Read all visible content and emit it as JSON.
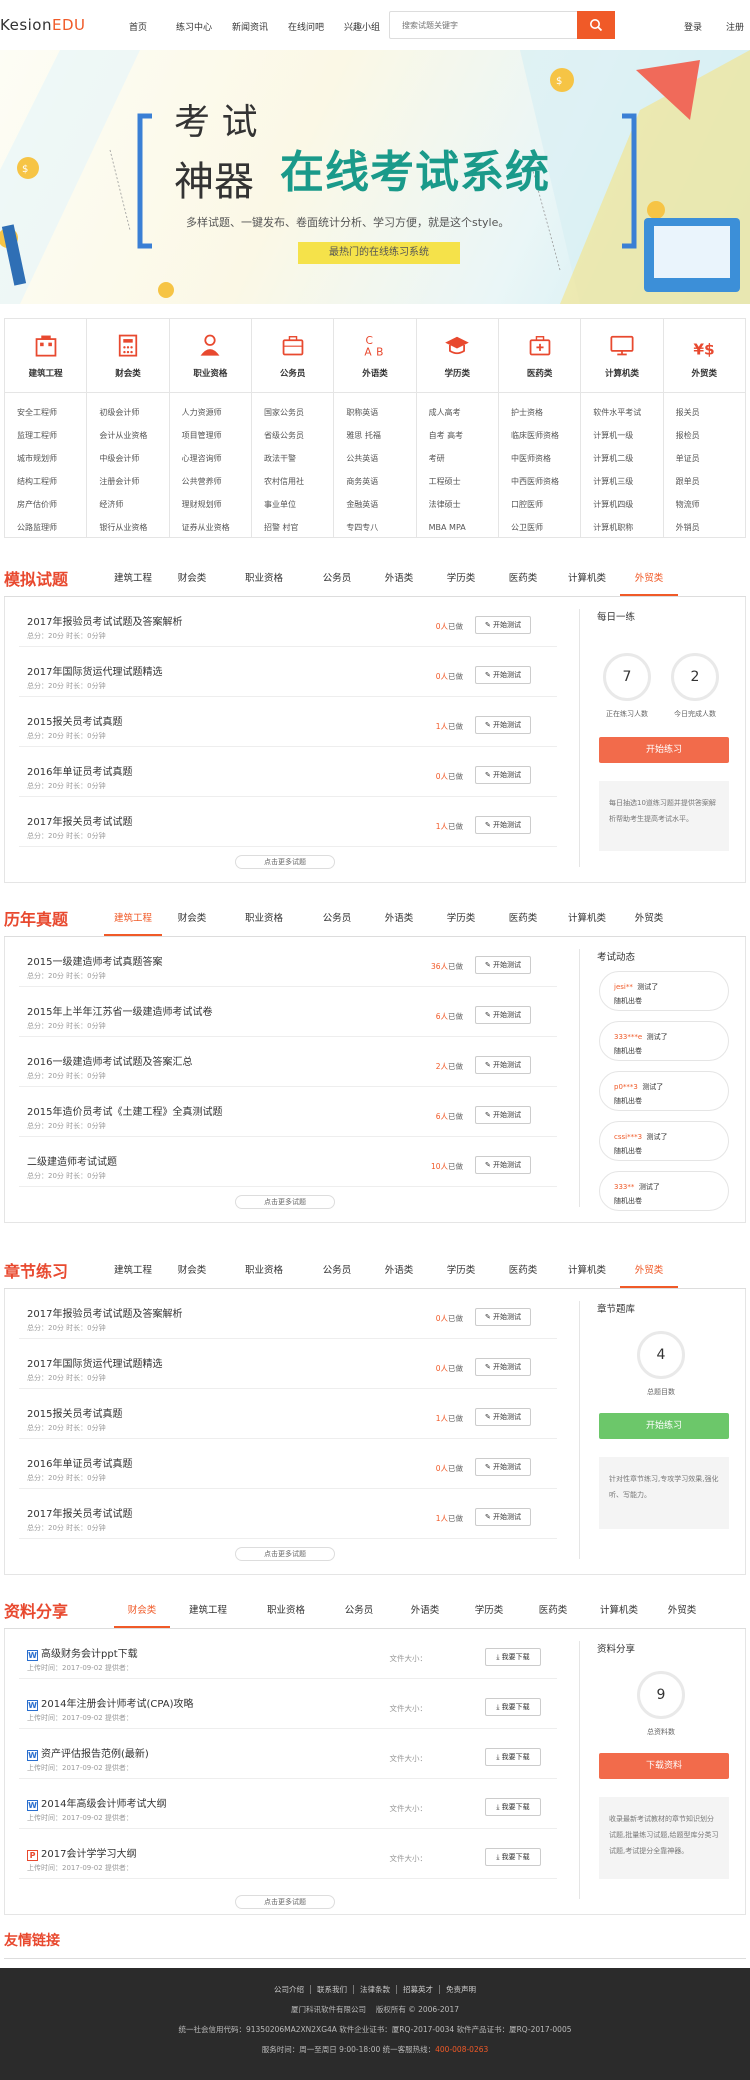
{
  "header": {
    "logo_main": "Kesion",
    "logo_edu": "EDU",
    "nav": [
      "首页",
      "练习中心",
      "新闻资讯",
      "在线问吧",
      "兴趣小组"
    ],
    "search_placeholder": "搜索试题关键字",
    "login": "登录",
    "register": "注册"
  },
  "banner": {
    "big1": "考 试",
    "big2": "神器",
    "title": "在线考试系统",
    "subtitle": "多样试题、一键发布、卷面统计分析、学习方便，就是这个style。",
    "tag": "最热门的在线练习系统"
  },
  "categories": [
    {
      "name": "建筑工程",
      "icon": "building-icon",
      "items": [
        "安全工程师",
        "监理工程师",
        "城市规划师",
        "结构工程师",
        "房产估价师",
        "公路监理师"
      ]
    },
    {
      "name": "财会类",
      "icon": "calculator-icon",
      "items": [
        "初级会计师",
        "会计从业资格",
        "中级会计师",
        "注册会计师",
        "经济师",
        "银行从业资格"
      ]
    },
    {
      "name": "职业资格",
      "icon": "person-icon",
      "items": [
        "人力资源师",
        "项目管理师",
        "心理咨询师",
        "公共营养师",
        "理财规划师",
        "证券从业资格"
      ]
    },
    {
      "name": "公务员",
      "icon": "briefcase-icon",
      "items": [
        "国家公务员",
        "省级公务员",
        "政法干警",
        "农村信用社",
        "事业单位",
        "招警    村官"
      ]
    },
    {
      "name": "外语类",
      "icon": "abc-icon",
      "items": [
        "职称英语",
        "雅思    托福",
        "公共英语",
        "商务英语",
        "金融英语",
        "专四专八"
      ]
    },
    {
      "name": "学历类",
      "icon": "graduation-cap-icon",
      "items": [
        "成人高考",
        "自考    高考",
        "考研",
        "工程硕士",
        "法律硕士",
        "MBA    MPA"
      ]
    },
    {
      "name": "医药类",
      "icon": "medical-kit-icon",
      "items": [
        "护士资格",
        "临床医师资格",
        "中医师资格",
        "中西医师资格",
        "口腔医师",
        "公卫医师"
      ]
    },
    {
      "name": "计算机类",
      "icon": "monitor-icon",
      "items": [
        "软件水平考试",
        "计算机一级",
        "计算机二级",
        "计算机三级",
        "计算机四级",
        "计算机职称"
      ]
    },
    {
      "name": "外贸类",
      "icon": "trade-icon",
      "items": [
        "报关员",
        "报检员",
        "单证员",
        "跟单员",
        "物流师",
        "外销员"
      ]
    }
  ],
  "mock": {
    "title": "模拟试题",
    "tabs": [
      "建筑工程",
      "财会类",
      "职业资格",
      "公务员",
      "外语类",
      "学历类",
      "医药类",
      "计算机类",
      "外贸类"
    ],
    "active": 8,
    "items": [
      {
        "title": "2017年报验员考试试题及答案解析",
        "meta": "总分：20分      时长：0分钟",
        "count": "0人",
        "done": "已做"
      },
      {
        "title": "2017年国际货运代理试题精选",
        "meta": "总分：20分      时长：0分钟",
        "count": "0人",
        "done": "已做"
      },
      {
        "title": "2015报关员考试真题",
        "meta": "总分：20分      时长：0分钟",
        "count": "1人",
        "done": "已做"
      },
      {
        "title": "2016年单证员考试真题",
        "meta": "总分：20分      时长：0分钟",
        "count": "0人",
        "done": "已做"
      },
      {
        "title": "2017年报关员考试试题",
        "meta": "总分：20分      时长：0分钟",
        "count": "1人",
        "done": "已做"
      }
    ],
    "btn": "开始测试",
    "more": "点击更多试题",
    "side": {
      "title": "每日一练",
      "n1": "7",
      "l1": "正在练习人数",
      "n2": "2",
      "l2": "今日完成人数",
      "btn": "开始练习",
      "note": "每日抽选10道练习题并提供答案解析帮助考生提高考试水平。"
    }
  },
  "past": {
    "title": "历年真题",
    "tabs": [
      "建筑工程",
      "财会类",
      "职业资格",
      "公务员",
      "外语类",
      "学历类",
      "医药类",
      "计算机类",
      "外贸类"
    ],
    "active": 0,
    "items": [
      {
        "title": "2015一级建造师考试真题答案",
        "meta": "总分：20分      时长：0分钟",
        "count": "36人",
        "done": "已做"
      },
      {
        "title": "2015年上半年江苏省一级建造师考试试卷",
        "meta": "总分：20分      时长：0分钟",
        "count": "6人",
        "done": "已做"
      },
      {
        "title": "2016一级建造师考试试题及答案汇总",
        "meta": "总分：20分      时长：0分钟",
        "count": "2人",
        "done": "已做"
      },
      {
        "title": "2015年造价员考试《土建工程》全真测试题",
        "meta": "总分：20分      时长：0分钟",
        "count": "6人",
        "done": "已做"
      },
      {
        "title": "二级建造师考试试题",
        "meta": "总分：20分      时长：0分钟",
        "count": "10人",
        "done": "已做"
      }
    ],
    "btn": "开始测试",
    "more": "点击更多试题",
    "side": {
      "title": "考试动态",
      "news": [
        {
          "user": "jesi**",
          "act": "测试了",
          "paper": "随机出卷"
        },
        {
          "user": "333***e",
          "act": "测试了",
          "paper": "随机出卷"
        },
        {
          "user": "p0***3",
          "act": "测试了",
          "paper": "随机出卷"
        },
        {
          "user": "cssi***3",
          "act": "测试了",
          "paper": "随机出卷"
        },
        {
          "user": "333**",
          "act": "测试了",
          "paper": "随机出卷"
        }
      ]
    }
  },
  "chapter": {
    "title": "章节练习",
    "tabs": [
      "建筑工程",
      "财会类",
      "职业资格",
      "公务员",
      "外语类",
      "学历类",
      "医药类",
      "计算机类",
      "外贸类"
    ],
    "active": 8,
    "items": [
      {
        "title": "2017年报验员考试试题及答案解析",
        "meta": "总分：20分      时长：0分钟",
        "count": "0人",
        "done": "已做"
      },
      {
        "title": "2017年国际货运代理试题精选",
        "meta": "总分：20分      时长：0分钟",
        "count": "0人",
        "done": "已做"
      },
      {
        "title": "2015报关员考试真题",
        "meta": "总分：20分      时长：0分钟",
        "count": "1人",
        "done": "已做"
      },
      {
        "title": "2016年单证员考试真题",
        "meta": "总分：20分      时长：0分钟",
        "count": "0人",
        "done": "已做"
      },
      {
        "title": "2017年报关员考试试题",
        "meta": "总分：20分      时长：0分钟",
        "count": "1人",
        "done": "已做"
      }
    ],
    "btn": "开始测试",
    "more": "点击更多试题",
    "side": {
      "title": "章节题库",
      "n1": "4",
      "l1": "总题目数",
      "btn": "开始练习",
      "note": "针对性章节练习,专攻学习效果,强化听、写能力。"
    }
  },
  "share": {
    "title": "资料分享",
    "tabs": [
      "财会类",
      "建筑工程",
      "职业资格",
      "公务员",
      "外语类",
      "学历类",
      "医药类",
      "计算机类",
      "外贸类"
    ],
    "active": 0,
    "items": [
      {
        "type": "W",
        "title": "高级财务会计ppt下载",
        "meta": "上传时间：2017-09-02      提供者：",
        "size": "文件大小："
      },
      {
        "type": "W",
        "title": "2014年注册会计师考试(CPA)攻略",
        "meta": "上传时间：2017-09-02      提供者：",
        "size": "文件大小："
      },
      {
        "type": "W",
        "title": "资产评估报告范例(最新)",
        "meta": "上传时间：2017-09-02      提供者：",
        "size": "文件大小："
      },
      {
        "type": "W",
        "title": "2014年高级会计师考试大纲",
        "meta": "上传时间：2017-09-02      提供者：",
        "size": "文件大小："
      },
      {
        "type": "P",
        "title": "2017会计学学习大纲",
        "meta": "上传时间：2017-09-02      提供者：",
        "size": "文件大小："
      }
    ],
    "btn": "我要下载",
    "more": "点击更多试题",
    "side": {
      "title": "资料分享",
      "n1": "9",
      "l1": "总资料数",
      "btn": "下载资料",
      "note": "收录最新考试教材的章节知识划分试题,批量练习试题,给题型库分类习试题,考试提分全靠神器。"
    }
  },
  "friends": {
    "title": "友情链接"
  },
  "footer": {
    "links": [
      "公司介绍",
      "联系我们",
      "法律条款",
      "招募英才",
      "免责声明"
    ],
    "line1": "厦门科讯软件有限公司  　版权所有 © 2006-2017",
    "line2": "统一社会信用代码：91350206MA2XN2XG4A 软件企业证书：厦RQ-2017-0034 软件产品证书：厦RQ-2017-0005",
    "line3": "服务时间：周一至周日 9:00-18:00 统一客服热线：",
    "hotline": "400-008-0263"
  },
  "colors": {
    "accent": "#f05a28",
    "green": "#6cc76a",
    "title_red": "#e8492f"
  }
}
